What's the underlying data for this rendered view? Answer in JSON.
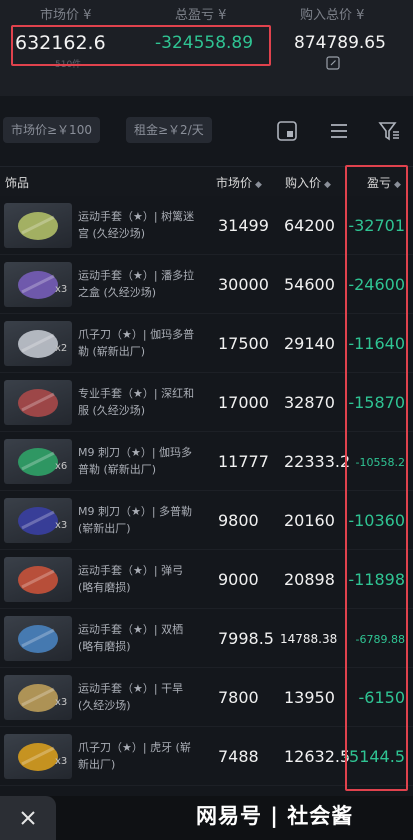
{
  "summary": {
    "market_label": "市场价 ¥",
    "market_value": "632162.6",
    "market_sub": "510件",
    "pl_label": "总盈亏 ¥",
    "pl_value": "-324558.89",
    "cost_label": "购入总价 ¥",
    "cost_value": "874789.65"
  },
  "filters": {
    "min_price": "市场价≥￥100",
    "rent": "租金≥￥2/天"
  },
  "table": {
    "col_item": "饰品",
    "col_market": "市场价",
    "col_buy": "购入价",
    "col_pl": "盈亏",
    "rows": [
      {
        "name": "运动手套（★）| 树篱迷宫 (久经沙场)",
        "qty": "",
        "market": "31499",
        "buy": "64200",
        "pl": "-32701",
        "color": "#b7c56a"
      },
      {
        "name": "运动手套（★）| 潘多拉之盒 (久经沙场)",
        "qty": "x3",
        "market": "30000",
        "buy": "54600",
        "pl": "-24600",
        "color": "#7a5fc0"
      },
      {
        "name": "爪子刀（★）| 伽玛多普勒 (崭新出厂)",
        "qty": "x2",
        "market": "17500",
        "buy": "29140",
        "pl": "-11640",
        "color": "#c9ced6"
      },
      {
        "name": "专业手套（★）| 深红和服 (久经沙场)",
        "qty": "",
        "market": "17000",
        "buy": "32870",
        "pl": "-15870",
        "color": "#b04a4a"
      },
      {
        "name": "M9 刺刀（★）| 伽玛多普勒 (崭新出厂)",
        "qty": "x6",
        "market": "11777",
        "buy": "22333.2",
        "pl": "-10558.2",
        "color": "#2fa86a"
      },
      {
        "name": "M9 刺刀（★）| 多普勒 (崭新出厂)",
        "qty": "x3",
        "market": "9800",
        "buy": "20160",
        "pl": "-10360",
        "color": "#3a3fa8"
      },
      {
        "name": "运动手套（★）| 弹弓 (略有磨损)",
        "qty": "",
        "market": "9000",
        "buy": "20898",
        "pl": "-11898",
        "color": "#d0543a"
      },
      {
        "name": "运动手套（★）| 双栖 (略有磨损)",
        "qty": "",
        "market": "7998.5",
        "buy": "14788.38",
        "pl": "-6789.88",
        "color": "#4a86c6"
      },
      {
        "name": "运动手套（★）| 干旱 (久经沙场)",
        "qty": "x3",
        "market": "7800",
        "buy": "13950",
        "pl": "-6150",
        "color": "#c4a35a"
      },
      {
        "name": "爪子刀（★）| 虎牙 (崭新出厂)",
        "qty": "x3",
        "market": "7488",
        "buy": "12632.5",
        "pl": "-5144.5",
        "color": "#e0a31c"
      }
    ]
  },
  "watermark": "网易号 | 社会酱",
  "colors": {
    "profit_green": "#2fc493",
    "highlight_red": "#e0424d"
  }
}
